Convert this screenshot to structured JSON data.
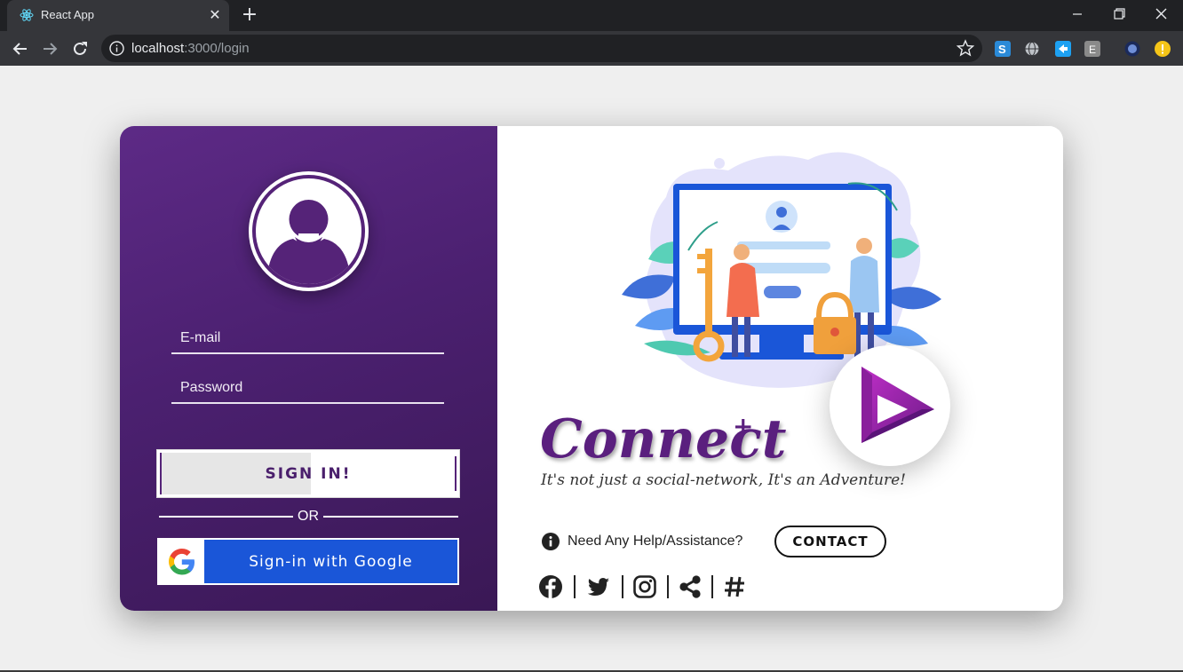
{
  "browser": {
    "tab_title": "React App",
    "url_host": "localhost",
    "url_path": ":3000/login"
  },
  "login": {
    "email_placeholder": "E-mail",
    "password_placeholder": "Password",
    "signin_label": "SIGN IN!",
    "or_text": "OR",
    "google_label": "Sign-in with Google"
  },
  "brand": {
    "name": "Connect",
    "plus": "+",
    "tagline": "It's not just a social-network, It's an Adventure!"
  },
  "help": {
    "text": "Need Any Help/Assistance?",
    "contact_label": "CONTACT"
  },
  "social_icons": [
    "facebook-icon",
    "twitter-icon",
    "instagram-icon",
    "share-icon",
    "hashtag-icon"
  ],
  "colors": {
    "primary_purple": "#552378",
    "google_blue": "#1a56d8",
    "chrome_dark": "#202124"
  }
}
